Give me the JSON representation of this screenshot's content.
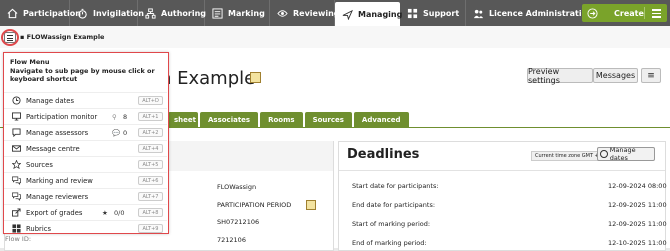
{
  "topnav": {
    "items": [
      {
        "label": "Participation",
        "icon": "house-icon"
      },
      {
        "label": "Invigilation",
        "icon": "stopwatch-icon"
      },
      {
        "label": "Authoring",
        "icon": "hierarchy-icon"
      },
      {
        "label": "Marking",
        "icon": "checklist-icon"
      },
      {
        "label": "Reviewing",
        "icon": "eye-icon"
      },
      {
        "label": "Managing",
        "icon": "airplane-icon"
      },
      {
        "label": "Support",
        "icon": "grid-icon"
      },
      {
        "label": "Licence Administration",
        "icon": "people-icon"
      }
    ],
    "create_label": "Create"
  },
  "breadcrumb": {
    "flow_title": "FLOWassign Example"
  },
  "page": {
    "title_fragment": "n Example",
    "preview_settings": "Preview settings",
    "messages": "Messages"
  },
  "tabs": [
    "sheet",
    "Associates",
    "Rooms",
    "Sources",
    "Advanced"
  ],
  "info": {
    "values": [
      "FLOWassign",
      "PARTICIPATION PERIOD",
      "SH07212106",
      "7212106"
    ],
    "flow_id_label": "Flow ID:"
  },
  "deadlines": {
    "title": "Deadlines",
    "timezone": "Current time zone GMT +1",
    "manage_dates": "Manage dates",
    "rows": [
      {
        "label": "Start date for participants:",
        "value": "12-09-2024 08:00"
      },
      {
        "label": "End date for participants:",
        "value": "12-09-2025 11:00"
      },
      {
        "label": "Start of marking period:",
        "value": "12-09-2025 11:00"
      },
      {
        "label": "End of marking period:",
        "value": "12-10-2025 11:00"
      }
    ]
  },
  "flow_menu": {
    "title": "Flow Menu",
    "subtitle": "Navigate to sub page by mouse click or keyboard shortcut",
    "items": [
      {
        "label": "Manage dates",
        "icon": "clock-icon",
        "shortcut": "ALT+D",
        "extra": ""
      },
      {
        "label": "Participation monitor",
        "icon": "monitor-icon",
        "shortcut": "ALT+1",
        "extra": "8"
      },
      {
        "label": "Manage assessors",
        "icon": "chat-icon",
        "shortcut": "ALT+2",
        "extra": "0"
      },
      {
        "label": "Message centre",
        "icon": "envelope-icon",
        "shortcut": "ALT+4",
        "extra": ""
      },
      {
        "label": "Sources",
        "icon": "star-icon",
        "shortcut": "ALT+5",
        "extra": ""
      },
      {
        "label": "Marking and review",
        "icon": "comments-icon",
        "shortcut": "ALT+6",
        "extra": ""
      },
      {
        "label": "Manage reviewers",
        "icon": "reviewers-icon",
        "shortcut": "ALT+7",
        "extra": ""
      },
      {
        "label": "Export of grades",
        "icon": "export-icon",
        "shortcut": "ALT+8",
        "extra": "0/0"
      },
      {
        "label": "Rubrics",
        "icon": "grid-icon",
        "shortcut": "ALT+9",
        "extra": ""
      }
    ]
  }
}
